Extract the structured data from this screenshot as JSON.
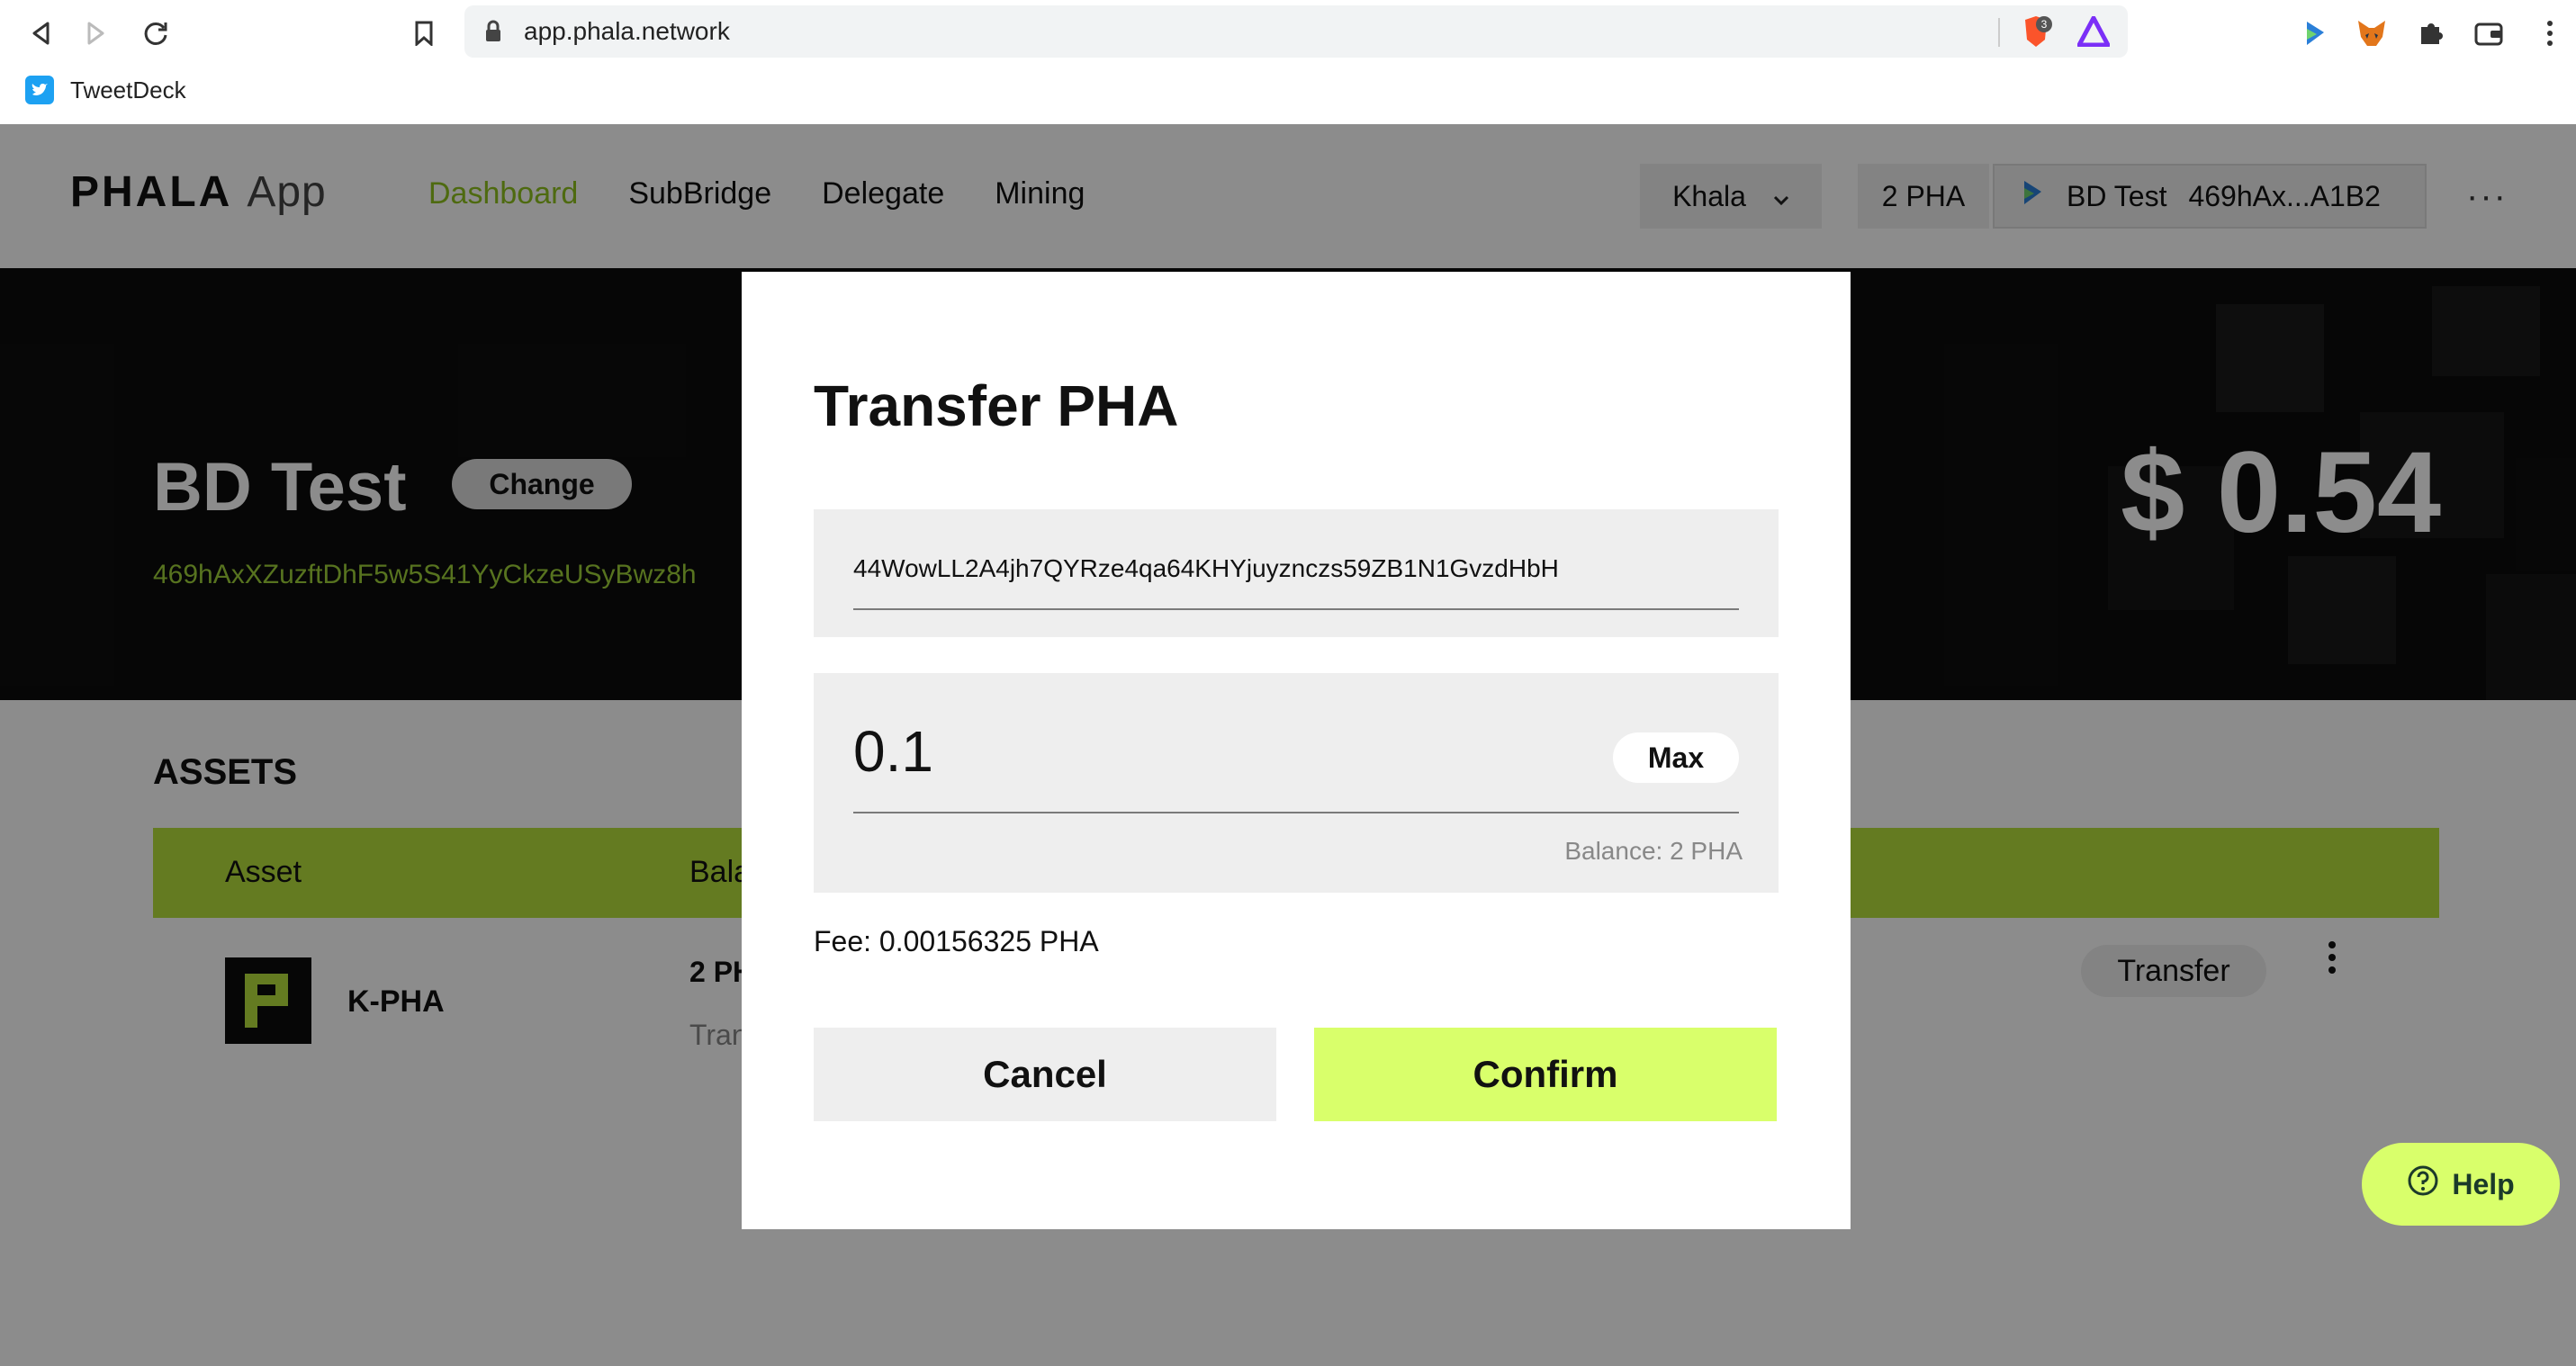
{
  "browser": {
    "url": "app.phala.network",
    "brave_badge_count": "3",
    "bookmarks": [
      {
        "label": "TweetDeck"
      }
    ]
  },
  "app": {
    "logo": "PHALA",
    "logo_suffix": "App",
    "nav": [
      {
        "label": "Dashboard",
        "active": true
      },
      {
        "label": "SubBridge"
      },
      {
        "label": "Delegate"
      },
      {
        "label": "Mining"
      }
    ],
    "network": "Khala",
    "account_balance": "2 PHA",
    "account_name": "BD Test",
    "account_short": "469hAx...A1B2",
    "more": "···"
  },
  "hero": {
    "name": "BD Test",
    "change_label": "Change",
    "address": "469hAxXZuzftDhF5w5S41YyCkzeUSyBwz8h",
    "value": "$ 0.54"
  },
  "assets": {
    "title": "ASSETS",
    "columns": [
      "Asset",
      "Bala"
    ],
    "rows": [
      {
        "name": "K-PHA",
        "balance": "2 PH",
        "sub": "Tran",
        "action": "Transfer"
      }
    ]
  },
  "modal": {
    "title": "Transfer PHA",
    "address_value": "44WowLL2A4jh7QYRze4qa64KHYjuyznczs59ZB1N1GvzdHbH",
    "amount_value": "0.1",
    "max_label": "Max",
    "balance_hint": "Balance: 2 PHA",
    "fee": "Fee: 0.00156325 PHA",
    "cancel_label": "Cancel",
    "confirm_label": "Confirm"
  },
  "help": {
    "label": "Help"
  },
  "colors": {
    "accent": "#b6e13c",
    "confirm": "#d9ff6b",
    "address_green": "#9fd13a"
  }
}
